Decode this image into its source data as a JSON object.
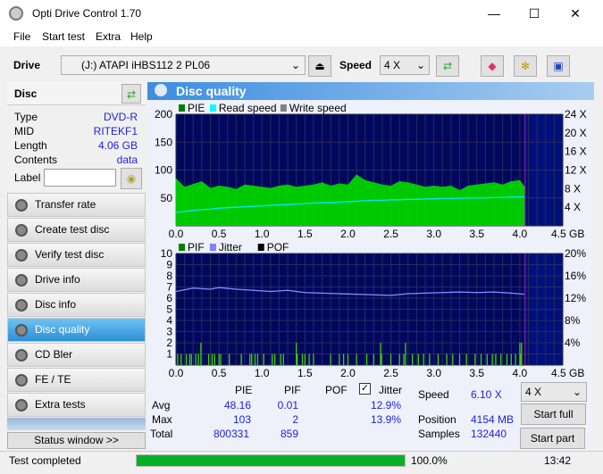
{
  "window": {
    "title": "Opti Drive Control 1.70",
    "minimize": "—",
    "maximize": "☐",
    "close": "✕"
  },
  "menu": [
    "File",
    "Start test",
    "Extra",
    "Help"
  ],
  "toolbar": {
    "drive_label": "Drive",
    "drive_value": "(J:)   ATAPI iHBS112   2 PL06",
    "speed_label": "Speed",
    "speed_value": "4 X"
  },
  "disc": {
    "title": "Disc",
    "rows": [
      {
        "k": "Type",
        "v": "DVD-R"
      },
      {
        "k": "MID",
        "v": "RITEKF1"
      },
      {
        "k": "Length",
        "v": "4.06 GB"
      },
      {
        "k": "Contents",
        "v": "data"
      }
    ],
    "label_key": "Label",
    "label_value": ""
  },
  "nav": [
    {
      "label": "Transfer rate"
    },
    {
      "label": "Create test disc"
    },
    {
      "label": "Verify test disc"
    },
    {
      "label": "Drive info"
    },
    {
      "label": "Disc info"
    },
    {
      "label": "Disc quality",
      "active": true
    },
    {
      "label": "CD Bler"
    },
    {
      "label": "FE / TE"
    },
    {
      "label": "Extra tests"
    }
  ],
  "status_window": "Status window >>",
  "panel_title": "Disc quality",
  "chart_data": [
    {
      "type": "bar",
      "legend": [
        "PIE",
        "Read speed",
        "Write speed"
      ],
      "legend_colors": [
        "#008000",
        "#00ffff",
        "#808080"
      ],
      "xlim": [
        0,
        4.5
      ],
      "xticks": [
        "0.0",
        "0.5",
        "1.0",
        "1.5",
        "2.0",
        "2.5",
        "3.0",
        "3.5",
        "4.0",
        "4.5 GB"
      ],
      "ylim": [
        0,
        200
      ],
      "yticks": [
        "200",
        "150",
        "100",
        "50"
      ],
      "y2ticks": [
        "24 X",
        "20 X",
        "16 X",
        "12 X",
        "8 X",
        "4 X"
      ],
      "y2lim": [
        0,
        24
      ],
      "x": [
        0.0,
        0.1,
        0.2,
        0.3,
        0.4,
        0.5,
        0.6,
        0.7,
        0.8,
        0.9,
        1.0,
        1.1,
        1.2,
        1.3,
        1.4,
        1.5,
        1.6,
        1.7,
        1.8,
        1.9,
        2.0,
        2.1,
        2.2,
        2.3,
        2.4,
        2.5,
        2.6,
        2.7,
        2.8,
        2.9,
        3.0,
        3.1,
        3.2,
        3.3,
        3.4,
        3.5,
        3.6,
        3.7,
        3.8,
        3.9,
        4.0,
        4.06
      ],
      "pie": [
        85,
        70,
        75,
        80,
        68,
        72,
        70,
        66,
        74,
        72,
        70,
        68,
        72,
        74,
        70,
        72,
        74,
        78,
        72,
        76,
        74,
        92,
        82,
        78,
        74,
        72,
        80,
        78,
        74,
        70,
        72,
        70,
        72,
        64,
        72,
        74,
        76,
        78,
        74,
        80,
        82,
        70
      ],
      "read_speed": [
        2.9,
        3.1,
        3.3,
        3.5,
        3.6,
        3.8,
        3.9,
        4.0,
        4.1,
        4.2,
        4.3,
        4.4,
        4.5,
        4.6,
        4.7,
        4.8,
        4.9,
        5.0,
        5.0,
        5.1,
        5.2,
        5.3,
        5.4,
        5.5,
        5.5,
        5.6,
        5.6,
        5.7,
        5.7,
        5.8,
        5.8,
        5.9,
        5.9,
        5.9,
        6.0,
        6.0,
        6.0,
        6.1,
        6.1,
        6.2,
        6.2,
        6.2
      ],
      "end_marker": 4.06
    },
    {
      "type": "bar",
      "legend": [
        "PIF",
        "Jitter",
        "POF"
      ],
      "legend_colors": [
        "#008000",
        "#8080ff",
        "#000000"
      ],
      "xlim": [
        0,
        4.5
      ],
      "xticks": [
        "0.0",
        "0.5",
        "1.0",
        "1.5",
        "2.0",
        "2.5",
        "3.0",
        "3.5",
        "4.0",
        "4.5 GB"
      ],
      "ylim": [
        0,
        10
      ],
      "yticks": [
        "10",
        "9",
        "8",
        "7",
        "6",
        "5",
        "4",
        "3",
        "2",
        "1"
      ],
      "y2ticks": [
        "20%",
        "16%",
        "12%",
        "8%",
        "4%"
      ],
      "y2lim": [
        0,
        20
      ],
      "pif_x": [
        0.02,
        0.06,
        0.12,
        0.16,
        0.18,
        0.23,
        0.26,
        0.29,
        0.38,
        0.42,
        0.45,
        0.5,
        0.52,
        0.62,
        0.76,
        0.86,
        0.88,
        0.92,
        0.95,
        1.02,
        1.12,
        1.15,
        1.22,
        1.25,
        1.4,
        1.41,
        1.47,
        1.5,
        1.55,
        1.6,
        1.8,
        1.9,
        1.95,
        2.0,
        2.1,
        2.22,
        2.3,
        2.38,
        2.39,
        2.5,
        2.6,
        2.65,
        2.67,
        2.75,
        2.82,
        2.88,
        2.95,
        3.05,
        3.15,
        3.22,
        3.3,
        3.38,
        3.48,
        3.55,
        3.62,
        3.68,
        3.72,
        3.78,
        3.85,
        3.9,
        3.95,
        4.0,
        4.01,
        4.02
      ],
      "pif_y": [
        1,
        1,
        1,
        1,
        1,
        1,
        1,
        2,
        1,
        1,
        1,
        1,
        1,
        1,
        1,
        1,
        1,
        1,
        1,
        1,
        1,
        1,
        1,
        1,
        2,
        1,
        1,
        1,
        1,
        1,
        1,
        1,
        1,
        1,
        1,
        1,
        1,
        2,
        1,
        1,
        1,
        1,
        2,
        1,
        1,
        1,
        1,
        1,
        1,
        1,
        1,
        1,
        1,
        1,
        1,
        1,
        1,
        1,
        1,
        1,
        1,
        2,
        1,
        2
      ],
      "jitter_x": [
        0.0,
        0.2,
        0.4,
        0.5,
        0.7,
        0.9,
        1.1,
        1.3,
        1.5,
        1.7,
        1.9,
        2.1,
        2.3,
        2.5,
        2.7,
        2.9,
        3.1,
        3.3,
        3.5,
        3.7,
        3.9,
        4.05
      ],
      "jitter": [
        13.2,
        13.8,
        13.6,
        13.9,
        13.6,
        13.4,
        13.2,
        13.4,
        13.0,
        12.9,
        12.8,
        12.7,
        12.6,
        12.5,
        12.8,
        12.9,
        13.0,
        13.1,
        13.0,
        13.1,
        12.9,
        12.7
      ],
      "end_marker": 4.06
    }
  ],
  "stats": {
    "headers": [
      "PIE",
      "PIF",
      "POF",
      "Jitter"
    ],
    "jitter_checked": true,
    "rows": [
      {
        "label": "Avg",
        "pie": "48.16",
        "pif": "0.01",
        "jitter": "12.9%"
      },
      {
        "label": "Max",
        "pie": "103",
        "pif": "2",
        "jitter": "13.9%"
      },
      {
        "label": "Total",
        "pie": "800331",
        "pif": "859"
      }
    ],
    "speed_label": "Speed",
    "speed_value": "6.10 X",
    "position_label": "Position",
    "position_value": "4154 MB",
    "samples_label": "Samples",
    "samples_value": "132440",
    "speed_select": "4 X",
    "start_full": "Start full",
    "start_part": "Start part"
  },
  "status": {
    "text": "Test completed",
    "progress": 100.0,
    "progress_text": "100.0%",
    "time": "13:42"
  }
}
